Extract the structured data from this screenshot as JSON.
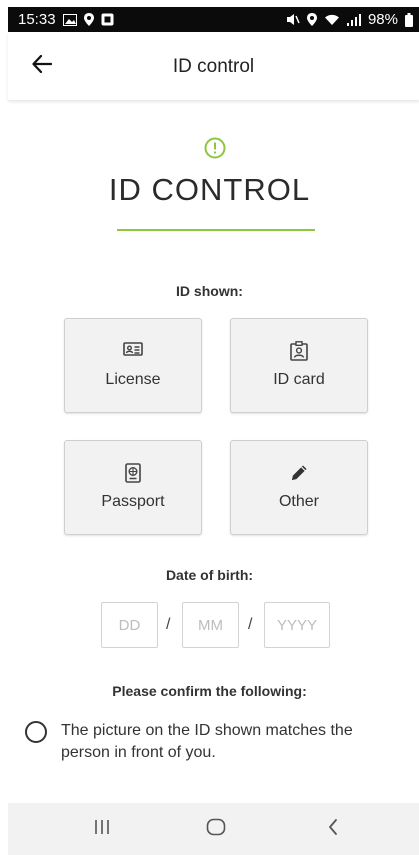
{
  "status_bar": {
    "time": "15:33",
    "battery": "98%"
  },
  "header": {
    "title": "ID control",
    "back_icon": "arrow-left-icon"
  },
  "main": {
    "title": "ID CONTROL",
    "accent_color": "#8dc63f",
    "id_shown_label": "ID shown:",
    "id_options": [
      {
        "label": "License",
        "icon": "license-icon"
      },
      {
        "label": "ID card",
        "icon": "id-card-icon"
      },
      {
        "label": "Passport",
        "icon": "passport-icon"
      },
      {
        "label": "Other",
        "icon": "pencil-icon"
      }
    ],
    "dob_label": "Date of birth:",
    "dob": {
      "day_placeholder": "DD",
      "month_placeholder": "MM",
      "year_placeholder": "YYYY",
      "separator": "/"
    },
    "confirm_label": "Please confirm the following:",
    "confirm_item": "The picture on the ID shown matches the person in front of you."
  }
}
